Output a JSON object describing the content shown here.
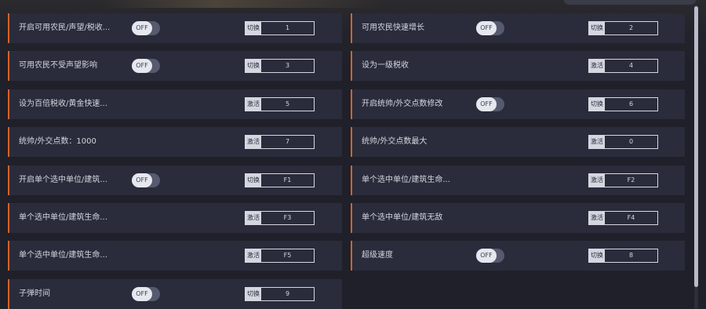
{
  "rows": [
    {
      "label": "开启可用农民/声望/税收...",
      "toggle": "OFF",
      "action": "切换",
      "key": "1"
    },
    {
      "label": "可用农民快速增长",
      "toggle": "OFF",
      "action": "切换",
      "key": "2"
    },
    {
      "label": "可用农民不受声望影响",
      "toggle": "OFF",
      "action": "切换",
      "key": "3"
    },
    {
      "label": "设为一级税收",
      "toggle": null,
      "action": "激活",
      "key": "4"
    },
    {
      "label": "设为百倍税收/黄金快速...",
      "toggle": null,
      "action": "激活",
      "key": "5"
    },
    {
      "label": "开启统帅/外交点数修改",
      "toggle": "OFF",
      "action": "切换",
      "key": "6"
    },
    {
      "label": "统帅/外交点数：1000",
      "toggle": null,
      "action": "激活",
      "key": "7"
    },
    {
      "label": "统帅/外交点数最大",
      "toggle": null,
      "action": "激活",
      "key": "0"
    },
    {
      "label": "开启单个选中单位/建筑...",
      "toggle": "OFF",
      "action": "切换",
      "key": "F1"
    },
    {
      "label": "单个选中单位/建筑生命...",
      "toggle": null,
      "action": "激活",
      "key": "F2"
    },
    {
      "label": "单个选中单位/建筑生命...",
      "toggle": null,
      "action": "激活",
      "key": "F3"
    },
    {
      "label": "单个选中单位/建筑无敌",
      "toggle": null,
      "action": "激活",
      "key": "F4"
    },
    {
      "label": "单个选中单位/建筑生命...",
      "toggle": null,
      "action": "激活",
      "key": "F5"
    },
    {
      "label": "超级速度",
      "toggle": "OFF",
      "action": "切换",
      "key": "8"
    },
    {
      "label": "子弹时间",
      "toggle": "OFF",
      "action": "切换",
      "key": "9"
    }
  ],
  "colors": {
    "accent": "#d4622a",
    "row_bg": "#2a2c3b",
    "page_bg": "#1f2029"
  }
}
